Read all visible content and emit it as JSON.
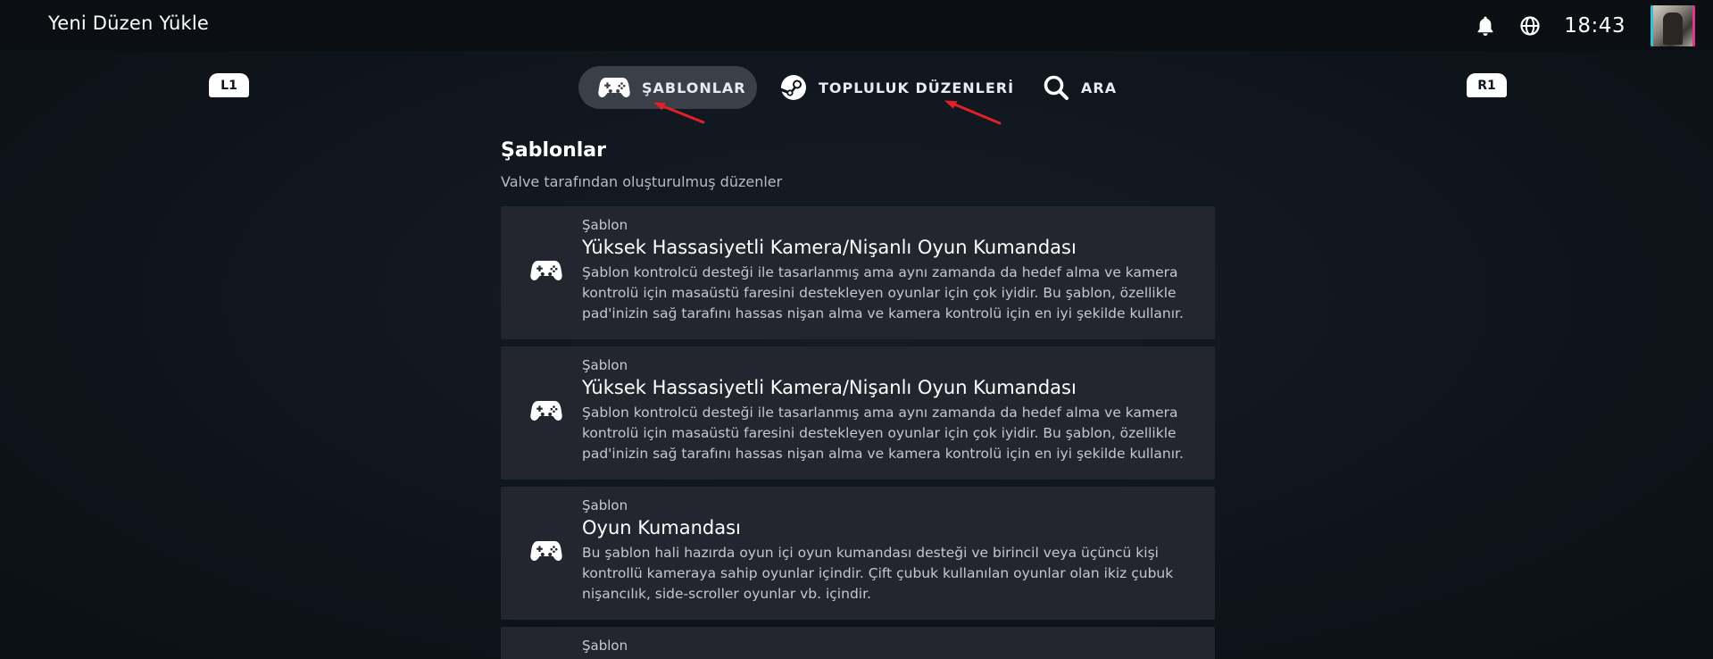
{
  "header": {
    "title": "Yeni Düzen Yükle",
    "time": "18:43"
  },
  "shoulders": {
    "left": "L1",
    "right": "R1"
  },
  "tabs": [
    {
      "label": "ŞABLONLAR",
      "icon": "gamepad-icon",
      "active": true
    },
    {
      "label": "TOPLULUK DÜZENLERİ",
      "icon": "steam-icon",
      "active": false
    },
    {
      "label": "ARA",
      "icon": "search-icon",
      "active": false
    }
  ],
  "section": {
    "title": "Şablonlar",
    "subtitle": "Valve tarafından oluşturulmuş düzenler"
  },
  "cards": [
    {
      "type": "Şablon",
      "name": "Yüksek Hassasiyetli Kamera/Nişanlı Oyun Kumandası",
      "desc": "Şablon kontrolcü desteği ile tasarlanmış ama aynı zamanda da hedef alma ve kamera kontrolü için masaüstü faresini destekleyen oyunlar için çok iyidir. Bu şablon, özellikle pad'inizin sağ tarafını hassas nişan alma ve kamera kontrolü için en iyi şekilde kullanır."
    },
    {
      "type": "Şablon",
      "name": "Yüksek Hassasiyetli Kamera/Nişanlı Oyun Kumandası",
      "desc": "Şablon kontrolcü desteği ile tasarlanmış ama aynı zamanda da hedef alma ve kamera kontrolü için masaüstü faresini destekleyen oyunlar için çok iyidir. Bu şablon, özellikle pad'inizin sağ tarafını hassas nişan alma ve kamera kontrolü için en iyi şekilde kullanır."
    },
    {
      "type": "Şablon",
      "name": "Oyun Kumandası",
      "desc": "Bu şablon hali hazırda oyun içi oyun kumandası desteği ve birincil veya üçüncü kişi kontrollü kameraya sahip oyunlar içindir. Çift çubuk kullanılan oyunlar olan ikiz çubuk nişancılık, side-scroller oyunlar vb. içindir."
    },
    {
      "type": "Şablon"
    }
  ],
  "colors": {
    "background": "#0e141b",
    "topbar": "#0b0e12",
    "card": "#23262e",
    "active_tab": "#3a3f48",
    "annotation_arrow": "#e0202a"
  }
}
